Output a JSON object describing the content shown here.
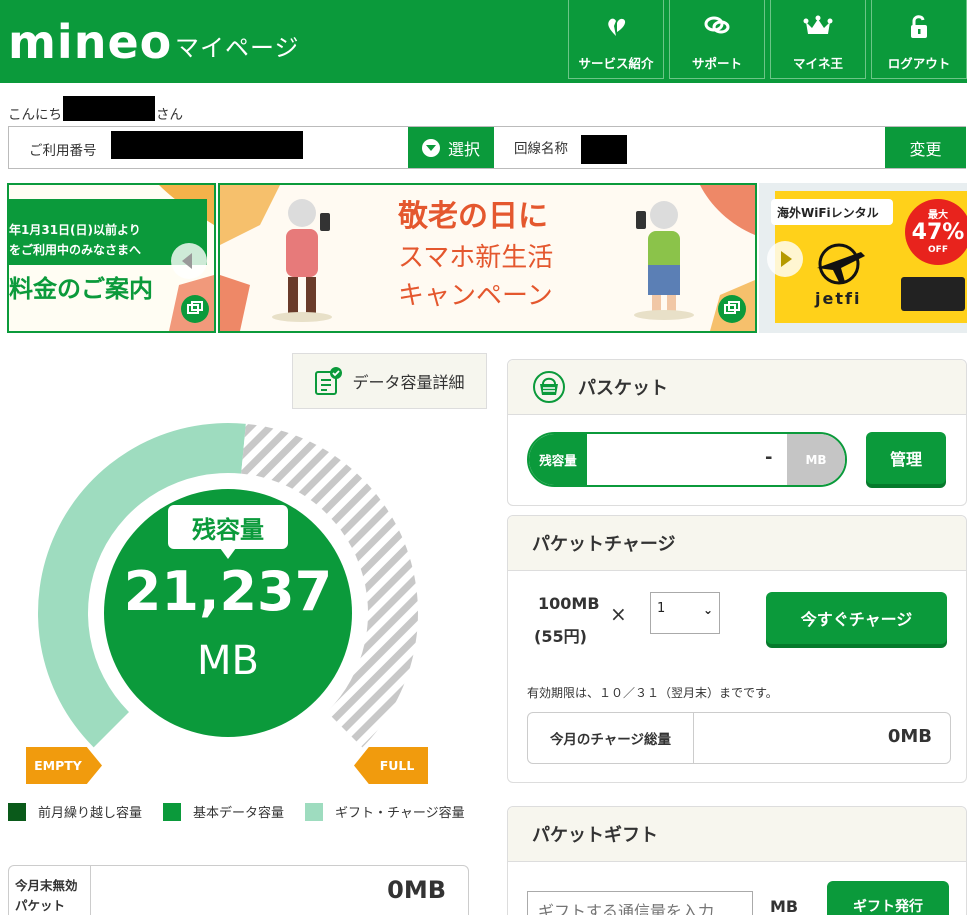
{
  "header": {
    "logo": "mineo",
    "title": "マイページ",
    "nav": [
      {
        "label": "サービス紹介",
        "icon": "heart-leaf-icon"
      },
      {
        "label": "サポート",
        "icon": "chat-bubbles-icon"
      },
      {
        "label": "マイネ王",
        "icon": "crown-icon"
      },
      {
        "label": "ログアウト",
        "icon": "unlock-icon"
      }
    ]
  },
  "greeting": {
    "prefix": "こんにち",
    "suffix": "さん"
  },
  "number_bar": {
    "number_label": "ご利用番号",
    "select_label": "選択",
    "line_name_label": "回線名称",
    "change_label": "変更"
  },
  "banners": {
    "b1": {
      "line1": "年1月31日(日)以前より",
      "line2": "をご利用中のみなさまへ",
      "line3": "料金のご案内"
    },
    "b2": {
      "line1": "敬老の日に",
      "line2": "スマホ新生活",
      "line3": "キャンペーン"
    },
    "b3": {
      "line1": "海外WiFiレンタル",
      "badge_top": "最大",
      "badge_value": "47%",
      "badge_suffix": "OFF",
      "brand": "jetfi"
    }
  },
  "gauge": {
    "detail_label": "データ容量詳細",
    "bubble_label": "残容量",
    "value": "21,237",
    "unit": "MB",
    "empty_label": "EMPTY",
    "full_label": "FULL",
    "remaining_fraction": 0.52,
    "legend": [
      {
        "label": "前月繰り越し容量",
        "color": "#0a5a1a"
      },
      {
        "label": "基本データ容量",
        "color": "#0b9a3b"
      },
      {
        "label": "ギフト・チャージ容量",
        "color": "#9edcbf"
      }
    ]
  },
  "expire": {
    "line1": "今月末無効",
    "line2": "パケット",
    "value": "0MB"
  },
  "basket": {
    "title": "パスケット",
    "remain_label": "残容量",
    "remain_value": "-",
    "remain_unit": "MB",
    "manage_label": "管理"
  },
  "charge": {
    "title": "パケットチャージ",
    "amount": "100MB",
    "price": "(55円)",
    "times": "×",
    "qty": "1",
    "charge_label": "今すぐチャージ",
    "note": "有効期限は、１０／３１（翌月末）までです。",
    "total_label": "今月のチャージ総量",
    "total_value": "0MB"
  },
  "gift": {
    "title": "パケットギフト",
    "placeholder": "ギフトする通信量を入力",
    "unit": "MB",
    "issue_label": "ギフト発行"
  },
  "colors": {
    "brand": "#0b9a3b",
    "orange": "#f19b0d",
    "light_green": "#9edcbf"
  }
}
